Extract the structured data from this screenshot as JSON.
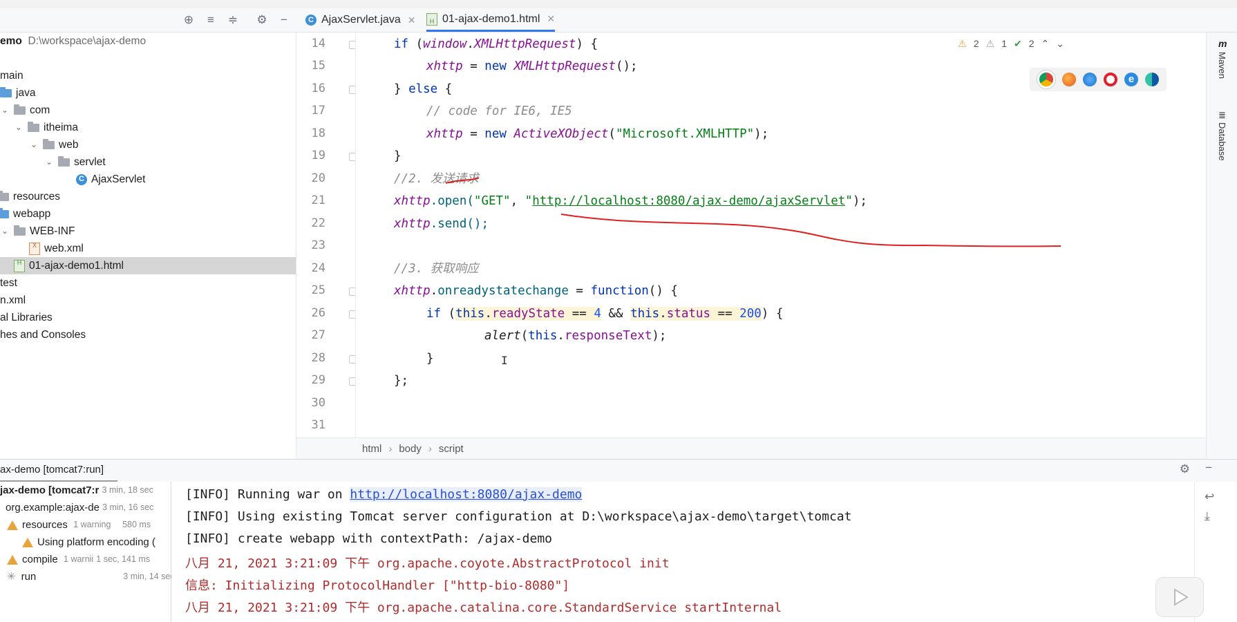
{
  "editor_tabs": [
    {
      "label": "AjaxServlet.java",
      "icon": "java-class-icon",
      "active": false
    },
    {
      "label": "01-ajax-demo1.html",
      "icon": "html-file-icon",
      "active": true
    }
  ],
  "project": {
    "root_name": "emo",
    "root_path": "D:\\workspace\\ajax-demo",
    "items": [
      {
        "label": "main"
      },
      {
        "label": "java"
      },
      {
        "label": "com"
      },
      {
        "label": "itheima"
      },
      {
        "label": "web"
      },
      {
        "label": "servlet"
      },
      {
        "label": "AjaxServlet"
      },
      {
        "label": "resources"
      },
      {
        "label": "webapp"
      },
      {
        "label": "WEB-INF"
      },
      {
        "label": "web.xml"
      },
      {
        "label": "01-ajax-demo1.html"
      },
      {
        "label": "test"
      },
      {
        "label": "n.xml"
      },
      {
        "label": "al Libraries"
      },
      {
        "label": "hes and Consoles"
      }
    ]
  },
  "code": {
    "line_numbers": [
      "14",
      "15",
      "16",
      "17",
      "18",
      "19",
      "20",
      "21",
      "22",
      "23",
      "24",
      "25",
      "26",
      "27",
      "28",
      "29",
      "30",
      "31"
    ],
    "l14": {
      "a": "if",
      "b": " (",
      "c": "window",
      "d": ".",
      "e": "XMLHttpRequest",
      "f": ") {"
    },
    "l15": {
      "a": "xhttp",
      "b": " = ",
      "c": "new",
      "d": " ",
      "e": "XMLHttpRequest",
      "f": "();"
    },
    "l16": {
      "a": "} ",
      "b": "else",
      "c": " {"
    },
    "l17": {
      "a": "// code for IE6, IE5"
    },
    "l18": {
      "a": "xhttp",
      "b": " = ",
      "c": "new",
      "d": " ",
      "e": "ActiveXObject",
      "f": "(",
      "g": "\"Microsoft.XMLHTTP\"",
      "h": ");"
    },
    "l19": {
      "a": "}"
    },
    "l20": {
      "a": "//2. 发送请求"
    },
    "l21": {
      "a": "xhttp",
      "b": ".open(",
      "c": "\"GET\"",
      "d": ", ",
      "e": "\"",
      "f": "http://localhost:8080/ajax-demo/ajaxServlet",
      "g": "\"",
      "h": ");"
    },
    "l22": {
      "a": "xhttp",
      "b": ".send();"
    },
    "l24": {
      "a": "//3. 获取响应"
    },
    "l25": {
      "a": "xhttp",
      "b": ".",
      "c": "onreadystatechange",
      "d": " = ",
      "e": "function",
      "f": "() {"
    },
    "l26": {
      "a": "if",
      "b": " (",
      "c": "this",
      "d": ".",
      "e": "readyState",
      "f": " == ",
      "g": "4",
      "h": " && ",
      "i": "this",
      "j": ".",
      "k": "status",
      "l": " == ",
      "m": "200",
      "n": ") {"
    },
    "l27": {
      "a": "alert",
      "b": "(",
      "c": "this",
      "d": ".",
      "e": "responseText",
      "f": ");"
    },
    "l28": {
      "a": "}"
    },
    "l29": {
      "a": "};"
    }
  },
  "inspections": {
    "warnings": "2",
    "weak_warnings": "1",
    "ok": "2"
  },
  "browsers": [
    "chrome-icon",
    "firefox-icon",
    "safari-icon",
    "opera-icon",
    "ie-icon",
    "edge-icon"
  ],
  "breadcrumb": [
    "html",
    "body",
    "script"
  ],
  "right_tools": [
    "Maven",
    "Database"
  ],
  "run": {
    "title": "ax-demo [tomcat7:run]",
    "tree": [
      {
        "label": "jax-demo [tomcat7:r",
        "time": "3 min, 18 sec"
      },
      {
        "label": "org.example:ajax-de",
        "time": "3 min, 16 sec"
      },
      {
        "label": "resources",
        "note": "1 warning",
        "time": "580 ms"
      },
      {
        "label": "Using platform encoding (",
        "time": ""
      },
      {
        "label": "compile",
        "note": "1 warnii",
        "time": "1 sec, 141 ms"
      },
      {
        "label": "run",
        "time": "3 min, 14 sec"
      }
    ],
    "console": {
      "l1_prefix": "[INFO] Running war on ",
      "l1_link": "http://localhost:8080/ajax-demo",
      "l2": "[INFO] Using existing Tomcat server configuration at D:\\workspace\\ajax-demo\\target\\tomcat",
      "l3": "[INFO] create webapp with contextPath: /ajax-demo",
      "l4": "八月 21, 2021 3:21:09 下午 org.apache.coyote.AbstractProtocol init",
      "l5": "信息: Initializing ProtocolHandler [\"http-bio-8080\"]",
      "l6": "八月 21, 2021 3:21:09 下午 org.apache.catalina.core.StandardService startInternal"
    }
  }
}
